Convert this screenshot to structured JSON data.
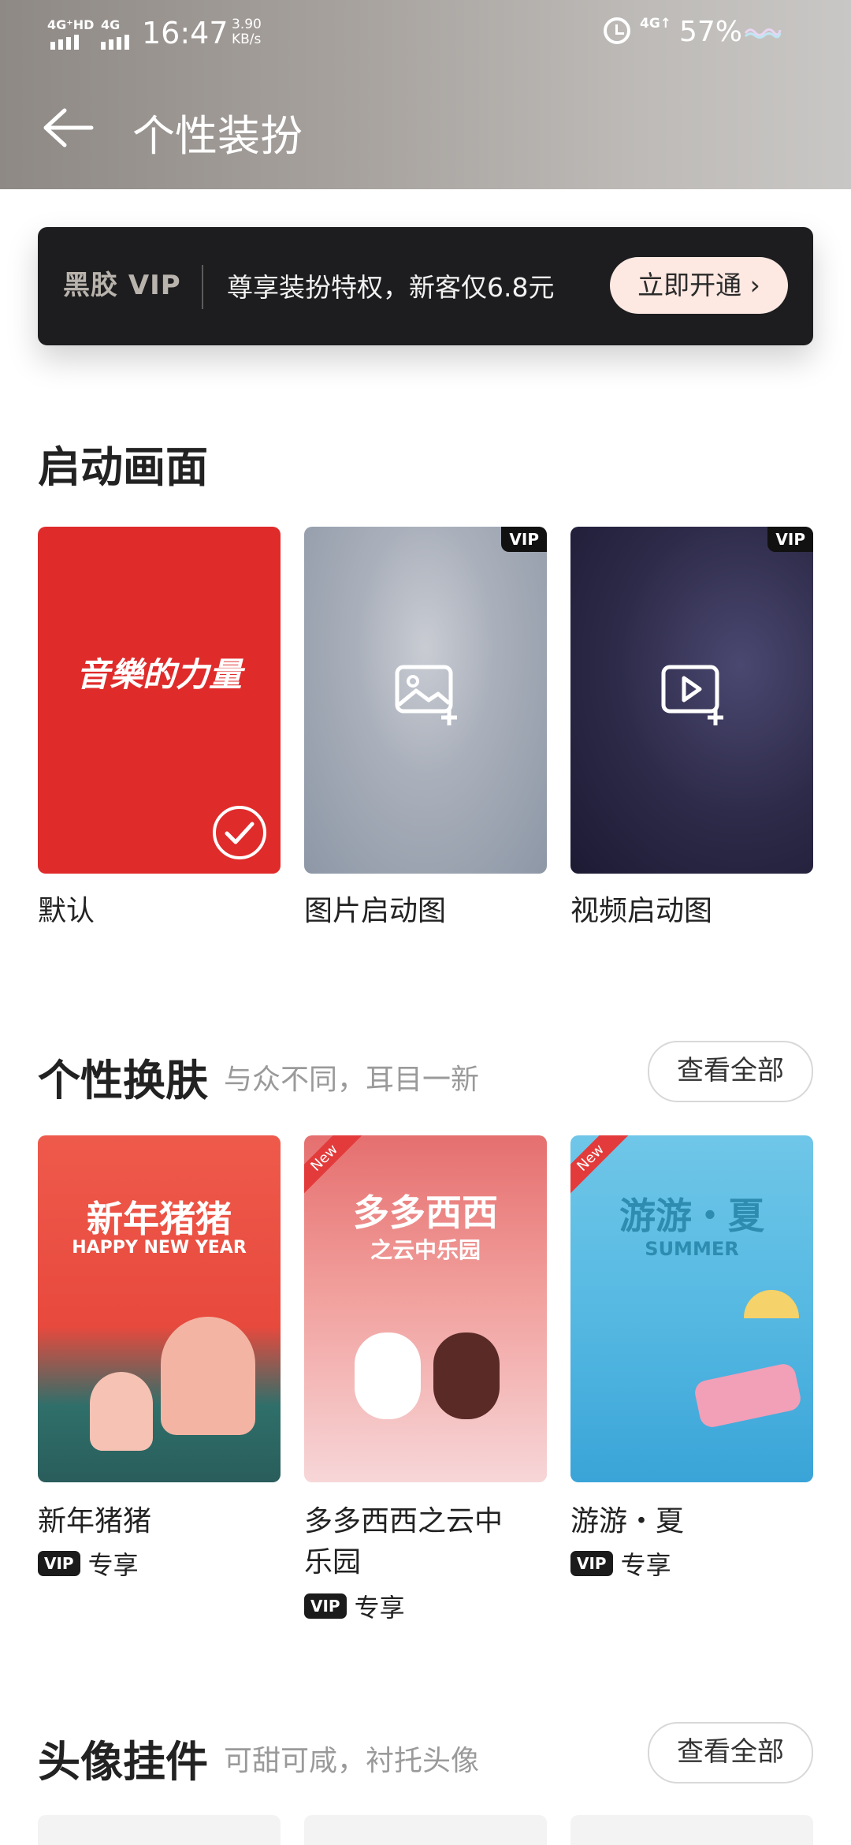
{
  "status_bar": {
    "signal1": "4G⁺HD",
    "signal2": "4G",
    "time": "16:47",
    "speed_value": "3.90",
    "speed_unit": "KB/s",
    "net2": "4G↑",
    "battery": "57%"
  },
  "header": {
    "title": "个性装扮"
  },
  "vip_banner": {
    "logo": "黑胶 VIP",
    "text": "尊享装扮特权，新客仅6.8元",
    "button_label": "立即开通 ›"
  },
  "startup": {
    "section_title": "启动画面",
    "items": [
      {
        "label": "默认",
        "card_text": "音樂的力量",
        "selected": true
      },
      {
        "label": "图片启动图",
        "vip_badge": "VIP"
      },
      {
        "label": "视频启动图",
        "vip_badge": "VIP"
      }
    ]
  },
  "skins": {
    "section_title": "个性换肤",
    "subtitle": "与众不同，耳目一新",
    "view_all": "查看全部",
    "items": [
      {
        "label": "新年猪猪",
        "art_title": "新年猪猪",
        "art_sub": "HAPPY NEW YEAR",
        "vip_badge": "VIP",
        "vip_text": "专享"
      },
      {
        "label_line1": "多多西西之云中",
        "label_line2": "乐园",
        "art_title": "多多西西",
        "art_sub": "之云中乐园",
        "new": "New",
        "vip_badge": "VIP",
        "vip_text": "专享"
      },
      {
        "label": "游游・夏",
        "art_title": "游游・夏",
        "art_sub": "SUMMER",
        "new": "New",
        "vip_badge": "VIP",
        "vip_text": "专享"
      }
    ]
  },
  "avatar_pendants": {
    "section_title": "头像挂件",
    "subtitle": "可甜可咸，衬托头像",
    "view_all": "查看全部"
  }
}
